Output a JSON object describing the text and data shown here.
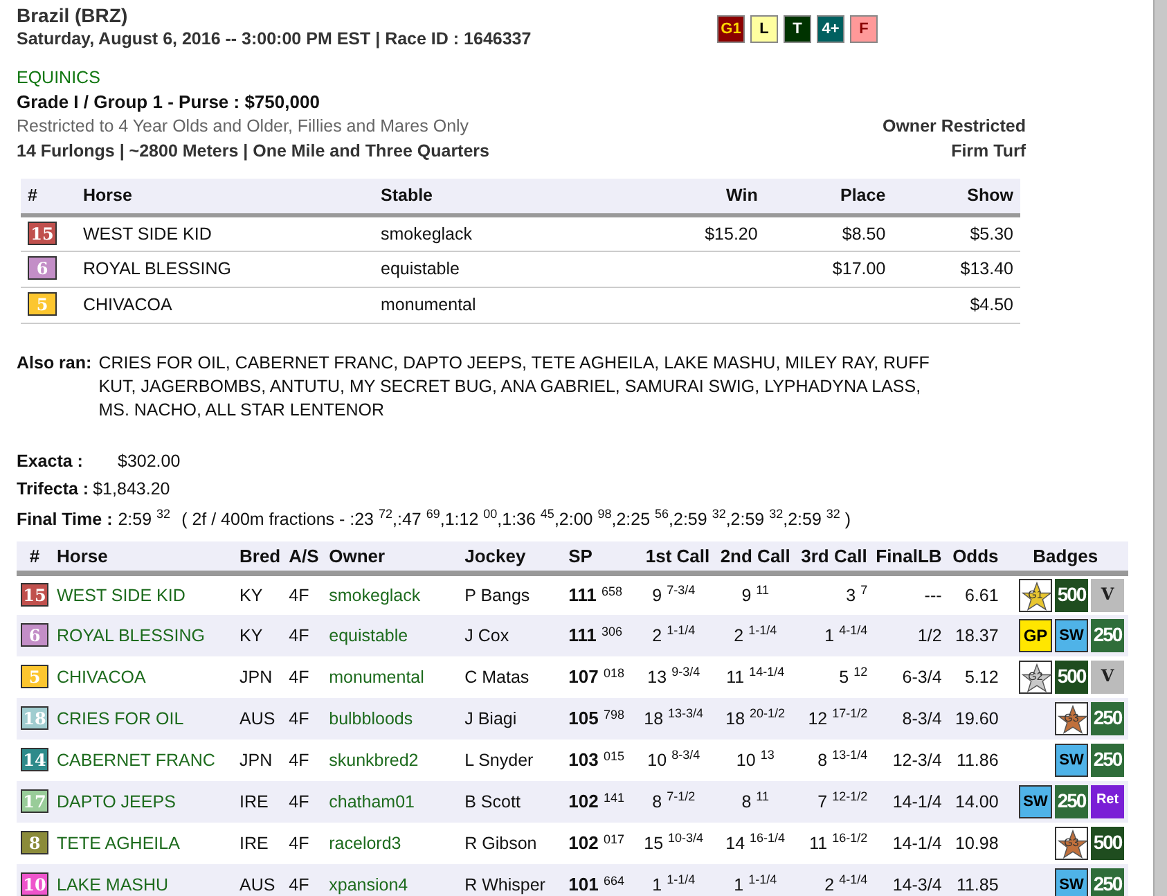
{
  "header": {
    "venue": "Brazil (BRZ)",
    "date_line": "Saturday, August 6, 2016 -- 3:00:00 PM EST | Race ID : 1646337",
    "race_tags": [
      {
        "label": "G1",
        "color": "#8b0000"
      },
      {
        "label": "L",
        "color": "#ffffa0"
      },
      {
        "label": "T",
        "color": "#003300"
      },
      {
        "label": "4+",
        "color": "#006060"
      },
      {
        "label": "F",
        "color": "#ff9999"
      }
    ]
  },
  "race": {
    "sponsor": "EQUINICS",
    "title": "Grade I / Group 1 - Purse : $750,000",
    "restriction": "Restricted to 4 Year Olds and Older, Fillies and Mares Only",
    "distance": "14 Furlongs | ~2800 Meters | One Mile and Three Quarters",
    "owner_restriction": "Owner Restricted",
    "surface": "Firm Turf"
  },
  "payouts": {
    "columns": [
      "#",
      "Horse",
      "Stable",
      "Win",
      "Place",
      "Show"
    ],
    "rows": [
      {
        "post": "15",
        "color": "#c0504d",
        "horse": "WEST SIDE KID",
        "stable": "smokeglack",
        "win": "$15.20",
        "place": "$8.50",
        "show": "$5.30"
      },
      {
        "post": "6",
        "color": "#c38ec7",
        "horse": "ROYAL BLESSING",
        "stable": "equistable",
        "place": "$17.00",
        "show": "$13.40"
      },
      {
        "post": "5",
        "color": "#fcc62f",
        "horse": "CHIVACOA",
        "stable": "monumental",
        "show": "$4.50"
      }
    ]
  },
  "also_ran": {
    "label": "Also ran:",
    "text": "CRIES FOR OIL, CABERNET FRANC, DAPTO JEEPS, TETE AGHEILA, LAKE MASHU, MILEY RAY, RUFF KUT, JAGERBOMBS, ANTUTU, MY SECRET BUG, ANA GABRIEL, SAMURAI SWIG, LYPHADYNA LASS, MS. NACHO, ALL STAR LENTENOR"
  },
  "exotics": [
    {
      "label": "Exacta :",
      "value": "$302.00"
    },
    {
      "label": "Trifecta :",
      "value": "$1,843.20"
    }
  ],
  "final_time": {
    "label": "Final Time :",
    "time": "2:59 $^{32}$",
    "fractions": "( 2f / 400m fractions - :23 $^{72}$,:47 $^{69}$,1:12 $^{00}$,1:36 $^{45}$,2:00 $^{98}$,2:25 $^{56}$,2:59 $^{32}$,2:59 $^{32}$,2:59 $^{32}$ )"
  },
  "results": {
    "columns": [
      "#",
      "Horse",
      "Bred",
      "A/S",
      "Owner",
      "Jockey",
      "SP",
      "1st Call",
      "2nd Call",
      "3rd Call",
      "FinalLB",
      "Odds",
      "Badges"
    ],
    "rows": [
      {
        "post": "15",
        "color": "#c0504d",
        "horse": "WEST SIDE KID",
        "bred": "KY",
        "age_sex": "4F",
        "owner": "smokeglack",
        "jockey": "P Bangs",
        "sp": "111 $^{658}$",
        "call_1": "9 $^{7-3/4}$",
        "call_2": "9 $^{11}$",
        "call_3": "3 $^{7}$",
        "final_lb": "---",
        "odds": "6.61",
        "badges": [
          {
            "kind": "star",
            "label": "G1",
            "color": "#e8c630"
          },
          {
            "kind": "points",
            "label": "500"
          },
          {
            "kind": "v",
            "label": "V"
          }
        ]
      },
      {
        "post": "6",
        "color": "#c38ec7",
        "horse": "ROYAL BLESSING",
        "bred": "KY",
        "age_sex": "4F",
        "owner": "equistable",
        "jockey": "J Cox",
        "sp": "111 $^{306}$",
        "call_1": "2 $^{1-1/4}$",
        "call_2": "2 $^{1-1/4}$",
        "call_3": "1 $^{4-1/4}$",
        "final_lb": "1/2",
        "odds": "18.37",
        "badges": [
          {
            "kind": "gp",
            "label": "GP"
          },
          {
            "kind": "sw",
            "label": "SW"
          },
          {
            "kind": "points",
            "label": "250"
          }
        ]
      },
      {
        "post": "5",
        "color": "#fcc62f",
        "horse": "CHIVACOA",
        "bred": "JPN",
        "age_sex": "4F",
        "owner": "monumental",
        "jockey": "C Matas",
        "sp": "107 $^{018}$",
        "call_1": "13 $^{9-3/4}$",
        "call_2": "11 $^{14-1/4}$",
        "call_3": "5 $^{12}$",
        "final_lb": "6-3/4",
        "odds": "5.12",
        "badges": [
          {
            "kind": "star",
            "label": "G2",
            "color": "#c8c8c8"
          },
          {
            "kind": "points",
            "label": "500"
          },
          {
            "kind": "v",
            "label": "V"
          }
        ]
      },
      {
        "post": "18",
        "color": "#a0cdd0",
        "horse": "CRIES FOR OIL",
        "bred": "AUS",
        "age_sex": "4F",
        "owner": "bulbbloods",
        "jockey": "J Biagi",
        "sp": "105 $^{798}$",
        "call_1": "18 $^{13-3/4}$",
        "call_2": "18 $^{20-1/2}$",
        "call_3": "12 $^{17-1/2}$",
        "final_lb": "8-3/4",
        "odds": "19.60",
        "badges": [
          {
            "kind": "star",
            "label": "G3",
            "color": "#c0703c"
          },
          {
            "kind": "points",
            "label": "250"
          }
        ]
      },
      {
        "post": "14",
        "color": "#2e8b8b",
        "horse": "CABERNET FRANC",
        "bred": "JPN",
        "age_sex": "4F",
        "owner": "skunkbred2",
        "jockey": "L Snyder",
        "sp": "103 $^{015}$",
        "call_1": "10 $^{8-3/4}$",
        "call_2": "10 $^{13}$",
        "call_3": "8 $^{13-1/4}$",
        "final_lb": "12-3/4",
        "odds": "11.86",
        "badges": [
          {
            "kind": "sw",
            "label": "SW"
          },
          {
            "kind": "points",
            "label": "250"
          }
        ]
      },
      {
        "post": "17",
        "color": "#99cc99",
        "horse": "DAPTO JEEPS",
        "bred": "IRE",
        "age_sex": "4F",
        "owner": "chatham01",
        "jockey": "B Scott",
        "sp": "102 $^{141}$",
        "call_1": "8 $^{7-1/2}$",
        "call_2": "8 $^{11}$",
        "call_3": "7 $^{12-1/2}$",
        "final_lb": "14-1/4",
        "odds": "14.00",
        "badges": [
          {
            "kind": "sw",
            "label": "SW"
          },
          {
            "kind": "points",
            "label": "250"
          },
          {
            "kind": "ret",
            "label": "Ret"
          }
        ]
      },
      {
        "post": "8",
        "color": "#8b8b3a",
        "horse": "TETE AGHEILA",
        "bred": "IRE",
        "age_sex": "4F",
        "owner": "racelord3",
        "jockey": "R Gibson",
        "sp": "102 $^{017}$",
        "call_1": "15 $^{10-3/4}$",
        "call_2": "14 $^{16-1/4}$",
        "call_3": "11 $^{16-1/2}$",
        "final_lb": "14-1/4",
        "odds": "10.98",
        "badges": [
          {
            "kind": "star",
            "label": "G3",
            "color": "#c0703c"
          },
          {
            "kind": "points",
            "label": "500"
          }
        ]
      },
      {
        "post": "10",
        "color": "#ee55cc",
        "horse": "LAKE MASHU",
        "bred": "AUS",
        "age_sex": "4F",
        "owner": "xpansion4",
        "jockey": "R Whisper",
        "sp": "101 $^{664}$",
        "call_1": "1 $^{1-1/4}$",
        "call_2": "1 $^{1-1/4}$",
        "call_3": "2 $^{4-1/4}$",
        "final_lb": "14-3/4",
        "odds": "11.85",
        "badges": [
          {
            "kind": "sw",
            "label": "SW"
          },
          {
            "kind": "points",
            "label": "250"
          }
        ]
      }
    ]
  }
}
